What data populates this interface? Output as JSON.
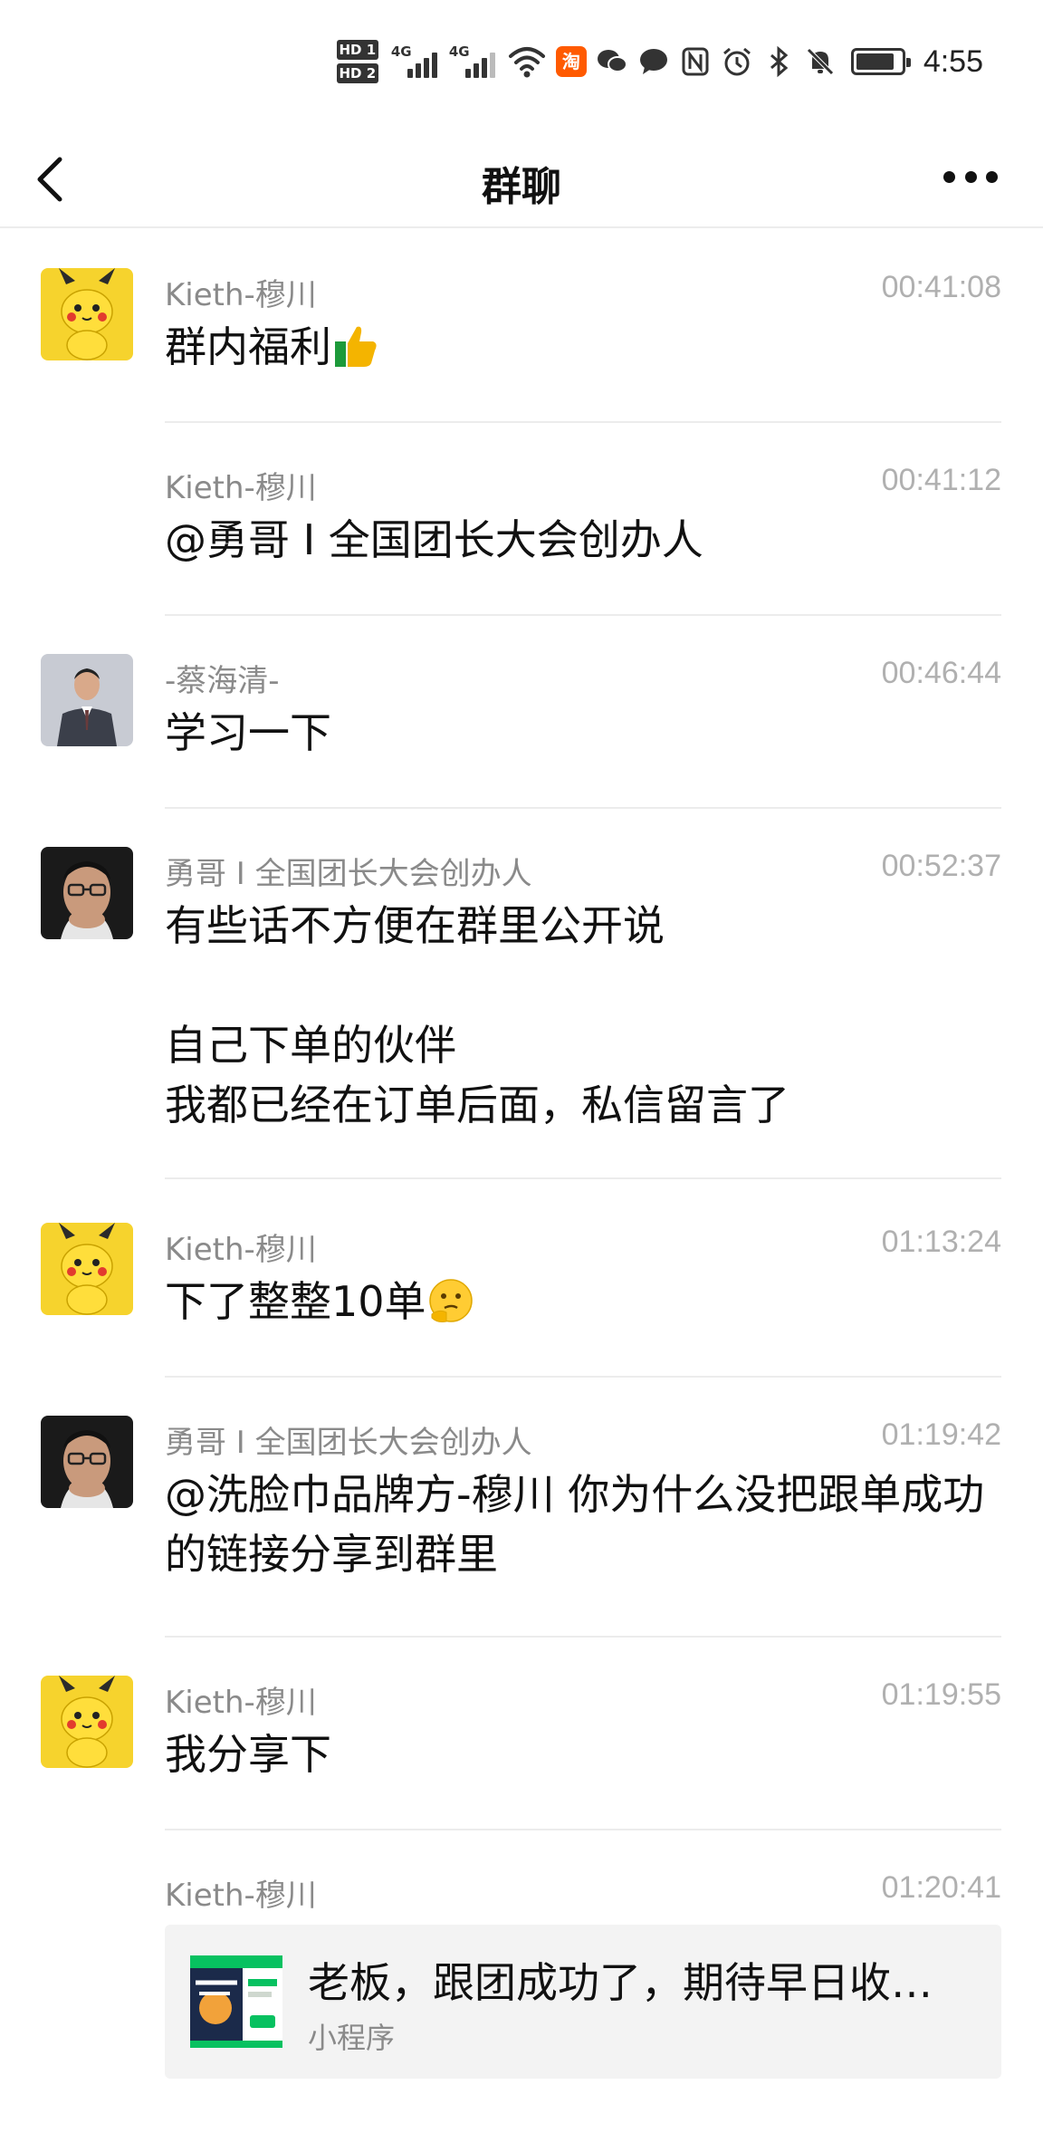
{
  "status_bar": {
    "hd1": "HD 1",
    "hd2": "HD 2",
    "net1": "4G",
    "net2": "4G",
    "taobao_glyph": "淘",
    "time": "4:55",
    "icons": [
      "signal-icon",
      "wifi-icon",
      "taobao-app-icon",
      "wechat-icon",
      "message-icon",
      "nfc-icon",
      "alarm-icon",
      "bluetooth-icon",
      "mute-icon",
      "battery-icon"
    ],
    "battery_level": 0.85
  },
  "nav": {
    "title": "群聊"
  },
  "messages": [
    {
      "sender": "Kieth-穆川",
      "time": "00:41:08",
      "text": "群内福利",
      "emoji": "thumbs-up",
      "avatar": "pikachu"
    },
    {
      "sender": "Kieth-穆川",
      "time": "00:41:12",
      "text": "@勇哥 I 全国团长大会创办人",
      "avatar": "none"
    },
    {
      "sender": "-蔡海清-",
      "time": "00:46:44",
      "text": "学习一下",
      "avatar": "man-suit"
    },
    {
      "sender": "勇哥 I 全国团长大会创办人",
      "time": "00:52:37",
      "text": "有些话不方便在群里公开说\n\n自己下单的伙伴\n我都已经在订单后面，私信留言了",
      "avatar": "man-glasses"
    },
    {
      "sender": "Kieth-穆川",
      "time": "01:13:24",
      "text": "下了整整10单",
      "emoji": "thinking",
      "avatar": "pikachu"
    },
    {
      "sender": "勇哥 I 全国团长大会创办人",
      "time": "01:19:42",
      "text": "@洗脸巾品牌方-穆川 你为什么没把跟单成功的链接分享到群里",
      "avatar": "man-glasses"
    },
    {
      "sender": "Kieth-穆川",
      "time": "01:19:55",
      "text": "我分享下",
      "avatar": "pikachu"
    },
    {
      "sender": "Kieth-穆川",
      "time": "01:20:41",
      "avatar": "none",
      "card": {
        "title": "老板，跟团成功了，期待早日收…",
        "subtitle": "小程序"
      }
    }
  ],
  "colors": {
    "accent_green": "#07c160",
    "timestamp_gray": "#b0b0b0",
    "sender_gray": "#8a8a8a",
    "pikachu_yellow": "#f6d32d"
  }
}
